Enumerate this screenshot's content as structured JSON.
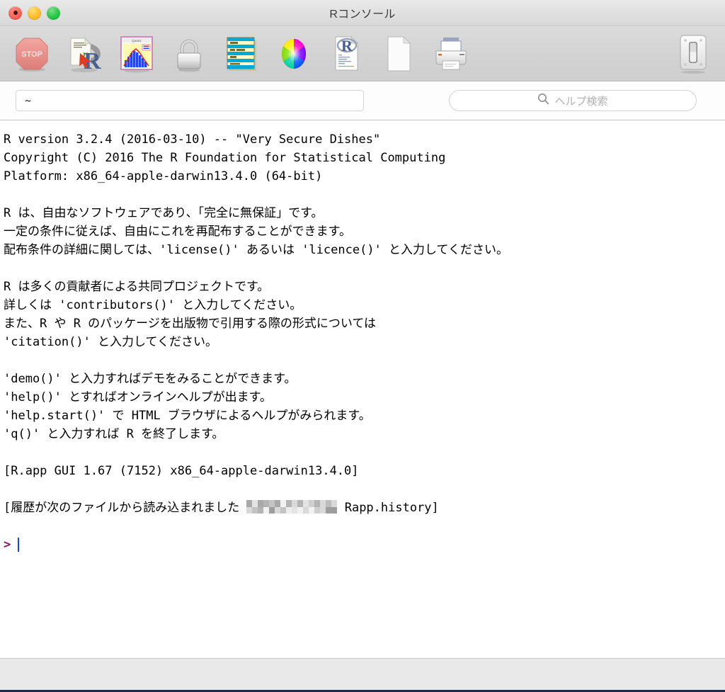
{
  "window": {
    "title": "Rコンソール",
    "controls": [
      {
        "name": "close",
        "color": "#f4685e"
      },
      {
        "name": "minimize",
        "color": "#fdc02f"
      },
      {
        "name": "zoom",
        "color": "#2ec94a"
      }
    ]
  },
  "toolbar": {
    "items": [
      {
        "name": "stop-button",
        "icon": "stop-icon",
        "label": "STOP"
      },
      {
        "name": "source-script-button",
        "icon": "r-script-icon",
        "label": ""
      },
      {
        "name": "quartz-plot-button",
        "icon": "quartz-plot-icon",
        "label": "Quartz"
      },
      {
        "name": "lock-button",
        "icon": "lock-icon",
        "label": ""
      },
      {
        "name": "workspace-browser-button",
        "icon": "data-table-icon",
        "label": ""
      },
      {
        "name": "color-picker-button",
        "icon": "color-wheel-icon",
        "label": ""
      },
      {
        "name": "r-document-button",
        "icon": "r-document-icon",
        "label": ""
      },
      {
        "name": "new-document-button",
        "icon": "blank-document-icon",
        "label": ""
      },
      {
        "name": "print-button",
        "icon": "printer-icon",
        "label": ""
      }
    ],
    "toggle": {
      "name": "toolbar-toggle-button",
      "icon": "switch-icon"
    }
  },
  "pathbar": {
    "path_value": "~",
    "path_placeholder": "",
    "search_placeholder": "ヘルプ検索"
  },
  "console": {
    "lines": [
      "R version 3.2.4 (2016-03-10) -- \"Very Secure Dishes\"",
      "Copyright (C) 2016 The R Foundation for Statistical Computing",
      "Platform: x86_64-apple-darwin13.4.0 (64-bit)",
      "",
      "R は、自由なソフトウェアであり、「完全に無保証」です。",
      "一定の条件に従えば、自由にこれを再配布することができます。",
      "配布条件の詳細に関しては、'license()' あるいは 'licence()' と入力してください。",
      "",
      "R は多くの貢献者による共同プロジェクトです。",
      "詳しくは 'contributors()' と入力してください。",
      "また、R や R のパッケージを出版物で引用する際の形式については",
      "'citation()' と入力してください。",
      "",
      "'demo()' と入力すればデモをみることができます。",
      "'help()' とすればオンラインヘルプが出ます。",
      "'help.start()' で HTML ブラウザによるヘルプがみられます。",
      "'q()' と入力すれば R を終了します。",
      "",
      "[R.app GUI 1.67 (7152) x86_64-apple-darwin13.4.0]",
      ""
    ],
    "history_line_prefix": "[履歴が次のファイルから読み込まれました ",
    "history_line_suffix": " Rapp.history]",
    "history_redacted": true,
    "prompt_symbol": ">",
    "prompt_input": "",
    "prompt_color": "#8a0f6e",
    "caret_color": "#1d3fe8"
  }
}
